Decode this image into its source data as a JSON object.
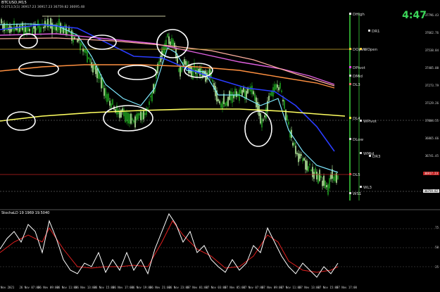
{
  "header": {
    "symbol_title": "BTCUSD,M15",
    "ohlc_line": "0:3713,5(1) 36917.23 36917.23 36759.82 36695.48"
  },
  "oscillator": {
    "title": "StochaLD 19 1969 19.5040",
    "levels": [
      "75",
      "50",
      "25"
    ]
  },
  "clock": {
    "text": "4:47",
    "color": "#3cd65a"
  },
  "price_axis": [
    "37796.43",
    "37662.76",
    "37538.84",
    "37405.00",
    "37273.79",
    "37129.26",
    "37004.55",
    "36865.66",
    "36741.45"
  ],
  "price_badges": {
    "last": "36917.23",
    "bid": "36759.82"
  },
  "time_axis": [
    "Nov 2021",
    "26 Nov 07:00",
    "26 Nov 09:00",
    "26 Nov 11:00",
    "26 Nov 13:00",
    "26 Nov 15:00",
    "26 Nov 17:00",
    "26 Nov 19:00",
    "26 Nov 21:00",
    "26 Nov 23:00",
    "27 Nov 01:00",
    "27 Nov 03:00",
    "27 Nov 05:00",
    "27 Nov 07:00",
    "27 Nov 09:00",
    "27 Nov 11:00",
    "27 Nov 13:00",
    "27 Nov 15:00",
    "27 Nov 17:00"
  ],
  "levels": [
    {
      "name": "DHigh",
      "color": "#ffffff"
    },
    {
      "name": "DR1",
      "color": "#dddddd"
    },
    {
      "name": "DOpen",
      "color": "#ffd040"
    },
    {
      "name": "WOpen",
      "color": "#ffd040"
    },
    {
      "name": "DPivot",
      "color": "#ff40ff"
    },
    {
      "name": "DMid",
      "color": "#dddddd"
    },
    {
      "name": "DL3",
      "color": "#ff7070"
    },
    {
      "name": "DL4",
      "color": "#ffff40"
    },
    {
      "name": "WPivot",
      "color": "#dddddd"
    },
    {
      "name": "DLow",
      "color": "#dddddd"
    },
    {
      "name": "WMid",
      "color": "#dddddd"
    },
    {
      "name": "DR3",
      "color": "#dddddd"
    },
    {
      "name": "DL5",
      "color": "#ff5050"
    },
    {
      "name": "WL3",
      "color": "#dddddd"
    },
    {
      "name": "WS1",
      "color": "#dddddd"
    }
  ],
  "colors": {
    "background": "#000000",
    "bull_candle": "#b8f0a0",
    "bear_candle": "#1fa01f",
    "ma_cyan": "#7ee8ff",
    "ma_blue": "#2a3cff",
    "ma_magenta": "#e060e0",
    "ma_orange": "#ff9040",
    "ma_pink": "#ffb0a0",
    "ma_yellow": "#ffff60",
    "stoch_main": "#ffffff",
    "stoch_signal": "#e02020",
    "separator_green": "#2ea02e"
  }
}
